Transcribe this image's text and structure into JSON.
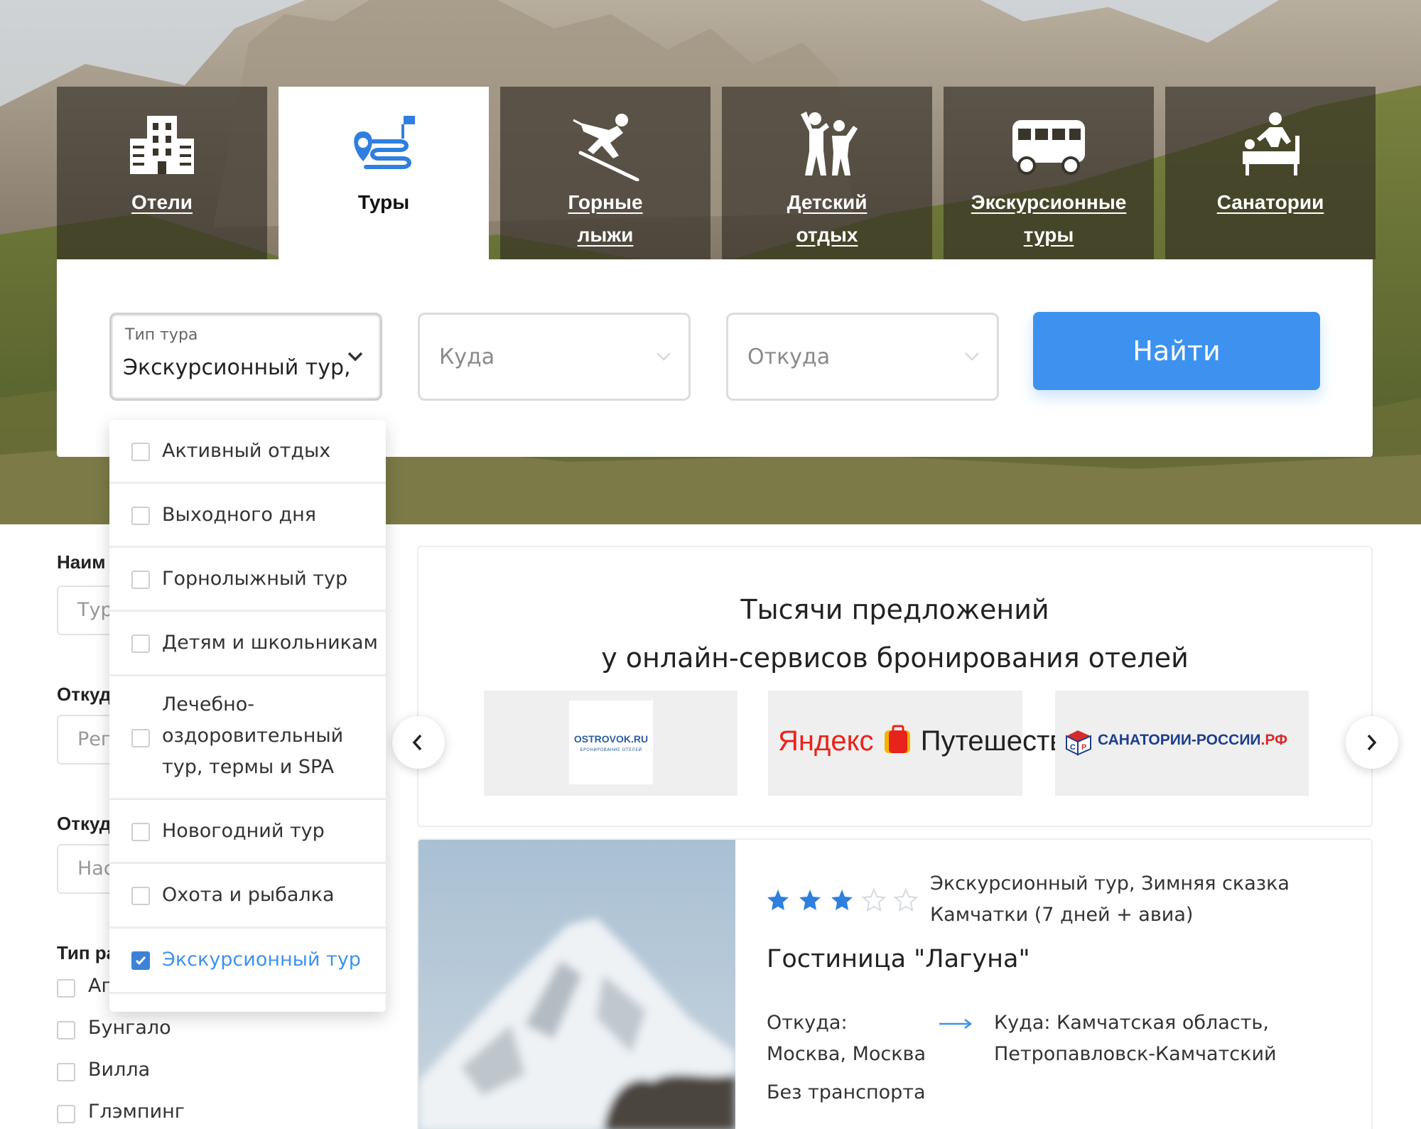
{
  "tabs": [
    {
      "label": "Отели",
      "icon": "hotel-icon",
      "active": false
    },
    {
      "label": "Туры",
      "icon": "route-icon",
      "active": true
    },
    {
      "label": "Горные лыжи",
      "icon": "skier-icon",
      "active": false
    },
    {
      "label": "Детский отдых",
      "icon": "children-icon",
      "active": false
    },
    {
      "label": "Экскурсионные туры",
      "icon": "bus-icon",
      "active": false
    },
    {
      "label": "Санатории",
      "icon": "massage-icon",
      "active": false
    }
  ],
  "search": {
    "tour_type_label": "Тип тура",
    "tour_type_value": "Экскурсионный тур,",
    "to_placeholder": "Куда",
    "from_placeholder": "Откуда",
    "find_button": "Найти"
  },
  "dropdown": {
    "options": [
      {
        "label": "Активный отдых",
        "checked": false
      },
      {
        "label": "Выходного дня",
        "checked": false
      },
      {
        "label": "Горнолыжный тур",
        "checked": false
      },
      {
        "label": "Детям и школьникам",
        "checked": false
      },
      {
        "label": "Лечебно-оздоровительный тур, термы и SPA",
        "checked": false
      },
      {
        "label": "Новогодний тур",
        "checked": false
      },
      {
        "label": "Охота и рыбалка",
        "checked": false
      },
      {
        "label": "Экскурсионный тур",
        "checked": true
      }
    ]
  },
  "sidebar": {
    "name_title": "Наим",
    "name_placeholder": "Тур",
    "from_title": "Откуд",
    "from_placeholder": "Реги",
    "from2_title": "Откуд",
    "from2_placeholder": "Нас",
    "placement_title": "Тип ра",
    "placement_options": [
      "Ап",
      "Бунгало",
      "Вилла",
      "Глэмпинг"
    ]
  },
  "partners": {
    "title_line1": "Тысячи предложений",
    "title_line2": "у онлайн-сервисов бронирования отелей",
    "ostrovok": {
      "name": "OSTROVOK.RU",
      "tagline": "БРОНИРОВАНИЕ ОТЕЛЕЙ"
    },
    "yandex": {
      "brand": "Яндекс",
      "product": "Путешествия"
    },
    "sanatorii": {
      "name": "САНАТОРИИ-РОССИИ",
      "suffix": ".РФ"
    }
  },
  "result": {
    "rating": 3,
    "rating_max": 5,
    "tour_name": "Экскурсионный тур, Зимняя сказка Камчатки (7 дней + авиа)",
    "hotel": "Гостиница \"Лагуна\"",
    "from": "Откуда: Москва, Москва",
    "to": "Куда: Камчатская область, Петропавловск-Камчатский",
    "transport": "Без транспорта"
  },
  "colors": {
    "accent": "#3d92f0",
    "star_active": "#2f7fe0",
    "star_inactive": "#d5d9e0"
  }
}
